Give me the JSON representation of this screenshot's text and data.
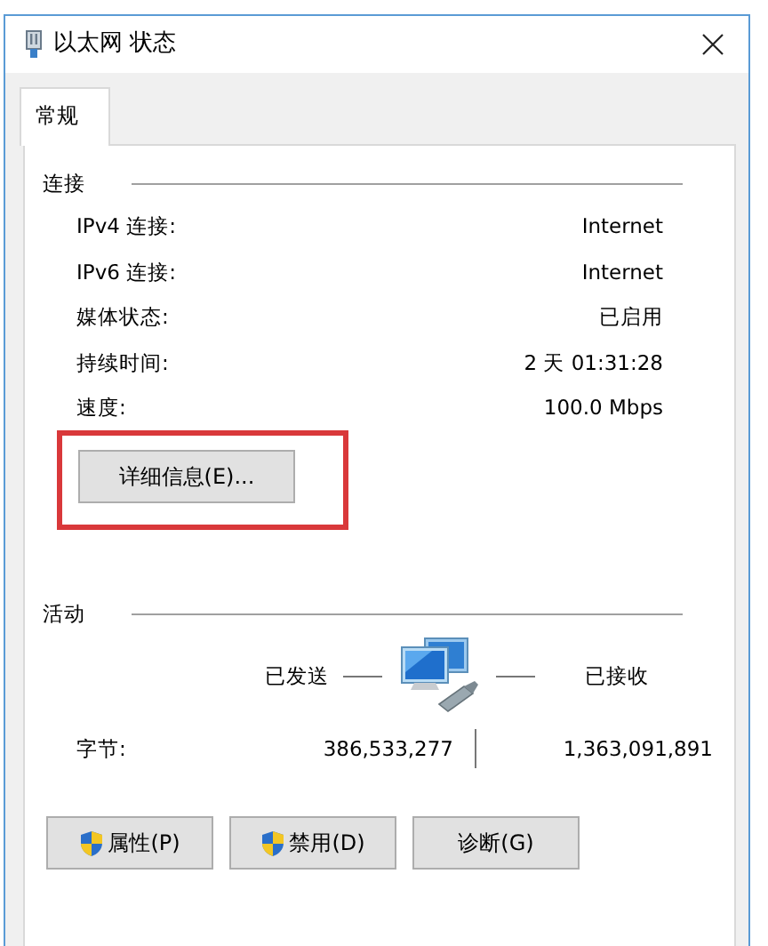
{
  "window": {
    "title": "以太网 状态"
  },
  "tabs": [
    {
      "label": "常规",
      "selected": true
    }
  ],
  "connection": {
    "heading": "连接",
    "rows": [
      {
        "label": "IPv4 连接:",
        "value": "Internet"
      },
      {
        "label": "IPv6 连接:",
        "value": "Internet"
      },
      {
        "label": "媒体状态:",
        "value": "已启用"
      },
      {
        "label": "持续时间:",
        "value": "2 天 01:31:28"
      },
      {
        "label": "速度:",
        "value": "100.0 Mbps"
      }
    ],
    "details_button": "详细信息(E)...",
    "highlighted": true
  },
  "activity": {
    "heading": "活动",
    "sent_label": "已发送",
    "received_label": "已接收",
    "bytes_label": "字节:",
    "bytes_sent": "386,533,277",
    "bytes_received": "1,363,091,891"
  },
  "buttons": [
    {
      "label": "属性(P)",
      "shield": true
    },
    {
      "label": "禁用(D)",
      "shield": true
    },
    {
      "label": "诊断(G)",
      "shield": false
    }
  ]
}
